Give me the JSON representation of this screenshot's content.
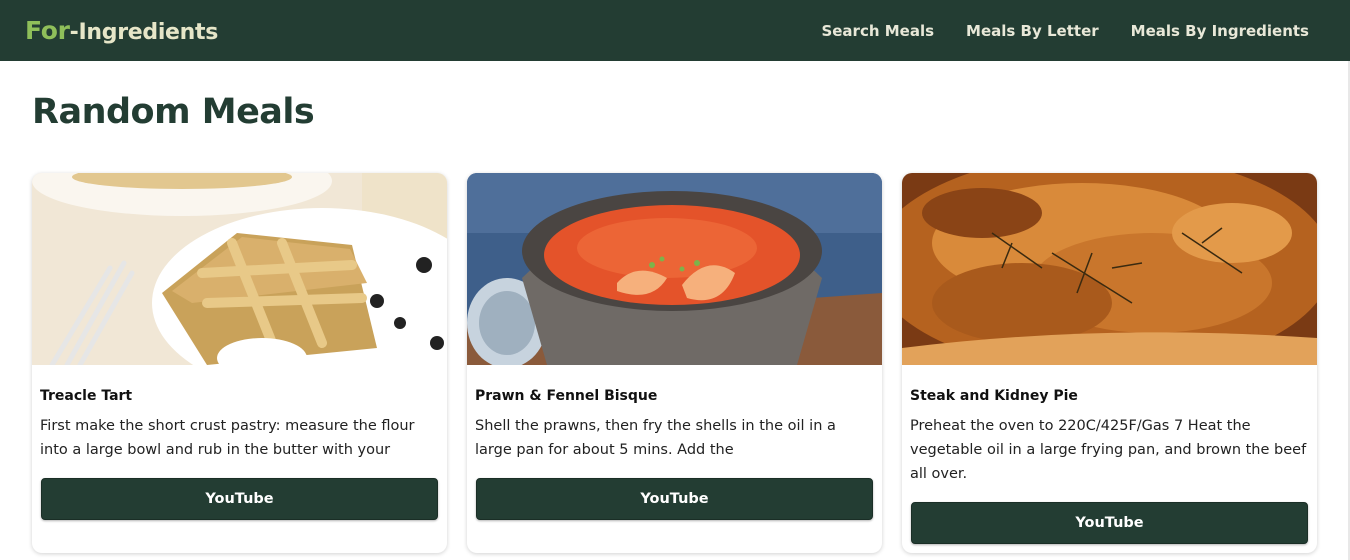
{
  "header": {
    "logo_accent": "For",
    "logo_rest": "-Ingredients",
    "nav": [
      "Search Meals",
      "Meals By Letter",
      "Meals By Ingredients"
    ]
  },
  "main": {
    "title": "Random Meals",
    "cards": [
      {
        "name": "Treacle Tart",
        "description": "First make the short crust pastry: measure the flour into a large bowl and rub in the butter with your",
        "button": "YouTube",
        "image_subject": "treacle-tart-photo"
      },
      {
        "name": "Prawn & Fennel Bisque",
        "description": "Shell the prawns, then fry the shells in the oil in a large pan for about 5 mins. Add the",
        "button": "YouTube",
        "image_subject": "prawn-bisque-photo"
      },
      {
        "name": "Steak and Kidney Pie",
        "description": "Preheat the oven to 220C/425F/Gas 7 Heat the vegetable oil in a large frying pan, and brown the beef all over.",
        "button": "YouTube",
        "image_subject": "steak-pie-photo"
      }
    ]
  },
  "colors": {
    "header_bg": "#233d33",
    "logo_accent": "#8fbf5a",
    "button_bg": "#233d33",
    "title": "#233d33"
  }
}
